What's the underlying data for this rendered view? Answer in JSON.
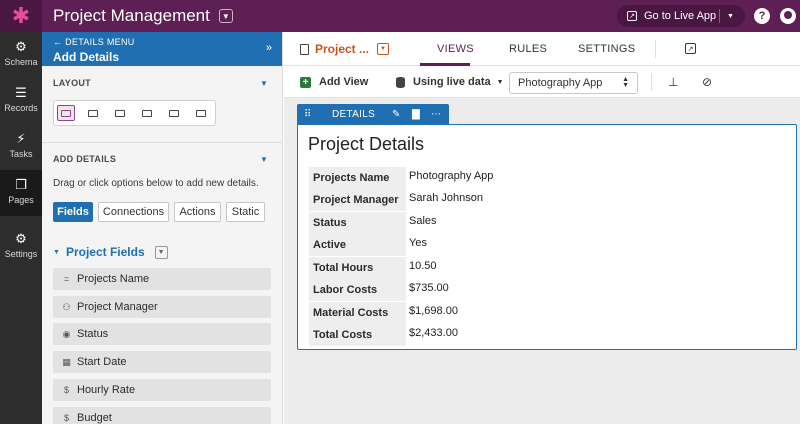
{
  "app": {
    "title": "Project Management",
    "live_label": "Go to Live App",
    "help": "?"
  },
  "rail": [
    {
      "label": "Schema",
      "icon": "schema-icon",
      "glyph": "⚙"
    },
    {
      "label": "Records",
      "icon": "database-icon",
      "glyph": "☰"
    },
    {
      "label": "Tasks",
      "icon": "lightning-icon",
      "glyph": "⚡"
    },
    {
      "label": "Pages",
      "icon": "pages-icon",
      "glyph": "❐"
    },
    {
      "label": "Settings",
      "icon": "gear-icon",
      "glyph": "⚙"
    }
  ],
  "panel": {
    "back_label": "DETAILS MENU",
    "title": "Add Details",
    "layout_label": "LAYOUT",
    "add_details_label": "ADD DETAILS",
    "hint": "Drag or click options below to add new details.",
    "tabs": [
      "Fields",
      "Connections",
      "Actions",
      "Static"
    ],
    "group_title": "Project Fields",
    "fields": [
      {
        "label": "Projects Name",
        "glyph": "="
      },
      {
        "label": "Project Manager",
        "glyph": "⚇"
      },
      {
        "label": "Status",
        "glyph": "◉"
      },
      {
        "label": "Start Date",
        "glyph": "▦"
      },
      {
        "label": "Hourly Rate",
        "glyph": "$"
      },
      {
        "label": "Budget",
        "glyph": "$"
      }
    ]
  },
  "nav": {
    "page_name": "Project ...",
    "tabs": [
      "VIEWS",
      "RULES",
      "SETTINGS"
    ]
  },
  "toolbar": {
    "add_view": "Add View",
    "live_data": "Using live data",
    "record": "Photography App"
  },
  "details": {
    "tab_label": "DETAILS",
    "title": "Project Details",
    "rows": [
      {
        "label": "Projects Name",
        "value": "Photography App"
      },
      {
        "label": "Project Manager",
        "value": "Sarah Johnson"
      },
      {
        "label": "Status",
        "value": "Sales"
      },
      {
        "label": "Active",
        "value": "Yes"
      },
      {
        "label": "Total Hours",
        "value": "10.50"
      },
      {
        "label": "Labor Costs",
        "value": "$735.00"
      },
      {
        "label": "Material Costs",
        "value": "$1,698.00"
      },
      {
        "label": "Total Costs",
        "value": "$2,433.00"
      }
    ]
  },
  "colors": {
    "brand": "#5e1f54",
    "accent": "#1f6fb2",
    "page_name": "#c8541d"
  }
}
